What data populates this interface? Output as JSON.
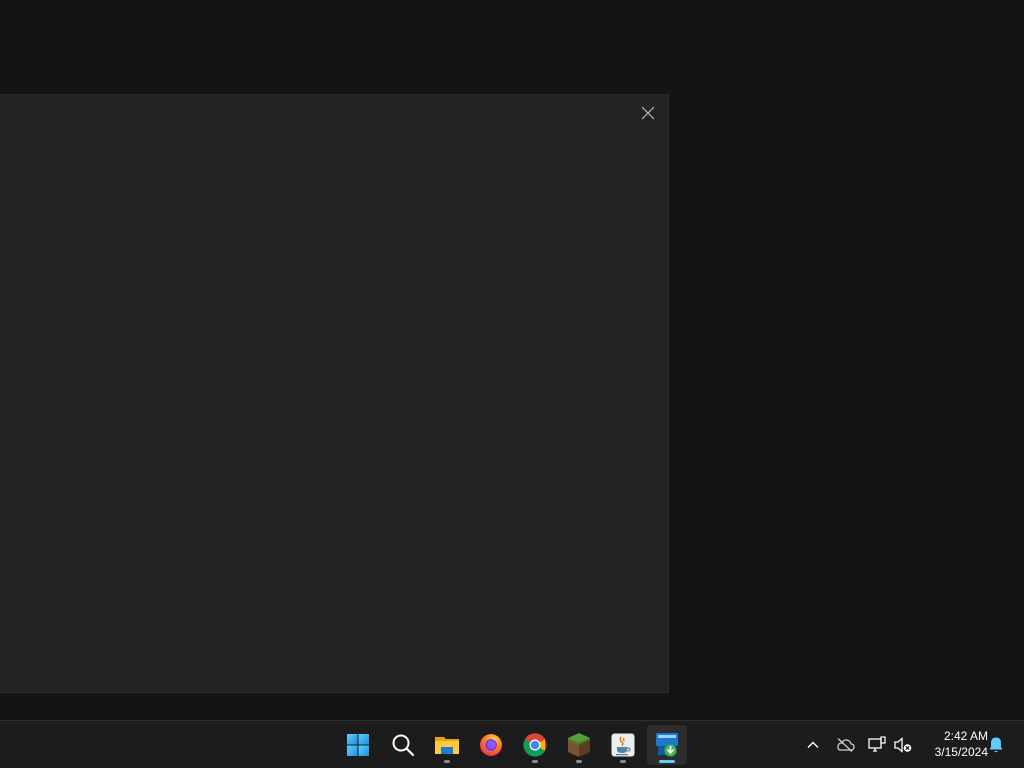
{
  "dialog": {
    "close_icon": "close-icon"
  },
  "taskbar": {
    "apps": [
      {
        "name": "start",
        "icon": "windows-logo-icon"
      },
      {
        "name": "search",
        "icon": "search-icon"
      },
      {
        "name": "file-explorer",
        "icon": "folder-icon",
        "running": true
      },
      {
        "name": "firefox",
        "icon": "firefox-icon"
      },
      {
        "name": "chrome",
        "icon": "chrome-icon",
        "running": true
      },
      {
        "name": "minecraft",
        "icon": "grass-block-icon",
        "running": true
      },
      {
        "name": "java",
        "icon": "java-icon",
        "running": true
      },
      {
        "name": "installer",
        "icon": "installer-icon",
        "running": true,
        "active": true
      }
    ],
    "tray": {
      "icons": [
        "chevron-up-icon",
        "onedrive-offline-icon",
        "network-icon",
        "volume-muted-icon",
        "notification-bell-icon"
      ],
      "time": "2:42 AM",
      "date": "3/15/2024"
    },
    "colors": {
      "active_indicator": "#60cdff",
      "notification": "#60cdff"
    }
  }
}
